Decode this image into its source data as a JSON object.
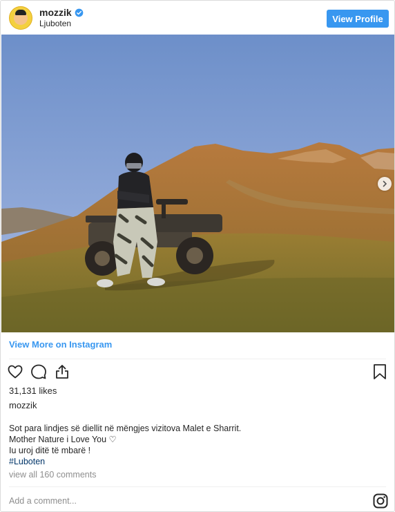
{
  "header": {
    "username": "mozzik",
    "location": "Ljuboten",
    "view_profile_label": "View Profile"
  },
  "post": {
    "view_more_label": "View More on Instagram",
    "likes": "31,131 likes",
    "author": "mozzik",
    "caption_lines": [
      "Sot para lindjes së diellit në mëngjes vizitova Malet e Sharrit.",
      "Mother Nature i Love You ♡",
      "Iu uroj ditë të mbarë !"
    ],
    "hashtag": "#Luboten",
    "comments_link": "view all 160 comments",
    "add_comment_placeholder": "Add a comment..."
  },
  "icons": {
    "avatar": "avatar",
    "verified": "verified-badge-icon",
    "next": "chevron-right-icon",
    "like": "heart-icon",
    "comment": "comment-icon",
    "share": "share-icon",
    "save": "bookmark-icon",
    "brand": "instagram-icon"
  },
  "colors": {
    "accent": "#3897f0",
    "hashtag": "#003569",
    "muted": "#8e8e8e"
  }
}
